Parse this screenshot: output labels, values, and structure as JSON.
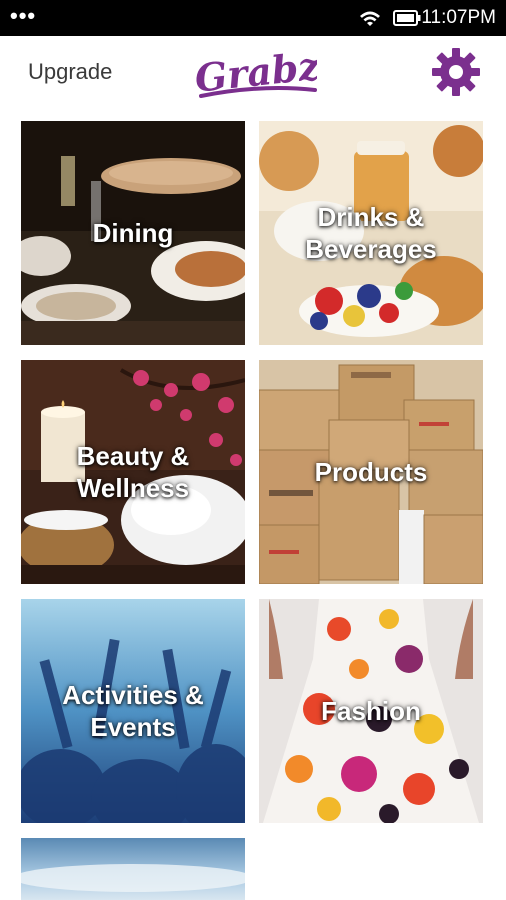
{
  "status_bar": {
    "time": "11:07PM",
    "menu_dots": "•••",
    "icons": [
      "wifi-icon",
      "battery-icon"
    ]
  },
  "app_bar": {
    "upgrade_label": "Upgrade",
    "logo_text": "Grabz",
    "settings_icon": "gear-icon",
    "brand_color": "#7b2f8e"
  },
  "categories": [
    {
      "label": "Dining"
    },
    {
      "label": "Drinks &\nBeverages"
    },
    {
      "label": "Beauty &\nWellness"
    },
    {
      "label": "Products"
    },
    {
      "label": "Activities &\nEvents"
    },
    {
      "label": "Fashion"
    },
    {
      "label": ""
    }
  ]
}
